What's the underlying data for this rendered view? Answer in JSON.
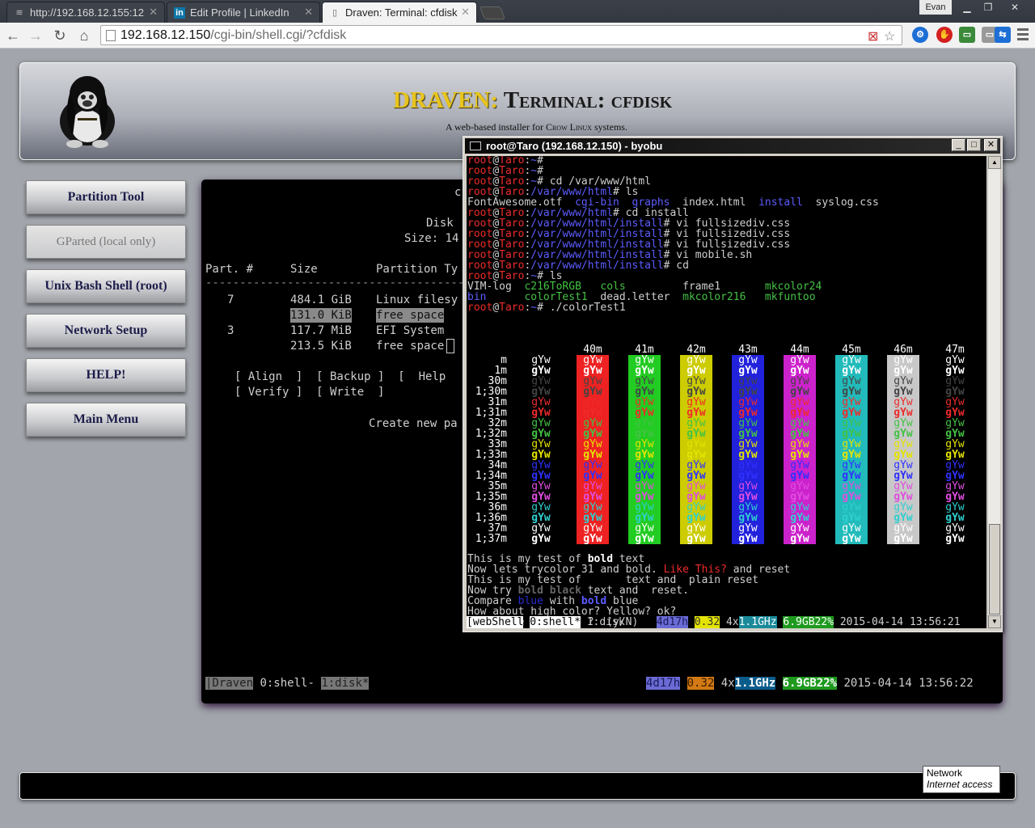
{
  "browser": {
    "tabs": [
      {
        "label": "http://192.168.12.155:12",
        "icon": "wifi-icon",
        "active": false
      },
      {
        "label": "Edit Profile | LinkedIn",
        "icon": "linkedin-icon",
        "active": false
      },
      {
        "label": "Draven: Terminal: cfdisk",
        "icon": "page-icon",
        "active": true
      }
    ],
    "user": "Evan",
    "url_host": "192.168.12.150",
    "url_path": "/cgi-bin/shell.cgi/?cfdisk"
  },
  "site": {
    "title_brand": "DRAVEN:",
    "title_rest": " Terminal: cfdisk",
    "tagline_pre": "A web-based installer for ",
    "tagline_brand": "Crow Linux",
    "tagline_post": " systems."
  },
  "sidebar": {
    "buttons": [
      {
        "label": "Partition Tool",
        "enabled": true
      },
      {
        "label": "GParted (local only)",
        "enabled": false
      },
      {
        "label": "Unix Bash Shell (root)",
        "enabled": true
      },
      {
        "label": "Network Setup",
        "enabled": true
      },
      {
        "label": "HELP!",
        "enabled": true
      },
      {
        "label": "Main Menu",
        "enabled": true
      }
    ]
  },
  "cfdisk": {
    "heading_c": "c",
    "disk_label": "Disk",
    "size_label": "Size: 14",
    "col_part": "Part. #",
    "col_size": "Size",
    "col_type": "Partition Ty",
    "rows": [
      {
        "part": "7",
        "size": "484.1 GiB",
        "type": "Linux filesy"
      },
      {
        "part": "",
        "size": "131.0 KiB",
        "type": "free space"
      },
      {
        "part": "3",
        "size": "117.7 MiB",
        "type": "EFI System"
      },
      {
        "part": "",
        "size": "213.5 KiB",
        "type": "free space"
      }
    ],
    "menu_line1": "[ Align  ]  [ Backup ]  [  Help",
    "menu_line2": "[ Verify ]  [ Write  ]",
    "hint": "Create new pa",
    "status": {
      "session": "|Draven",
      "win0": " 0:shell- ",
      "win1": "1:disk*",
      "uptime": "4d17h",
      "load": "0.32",
      "cpu_count": "4x",
      "cpu_freq": "1.1GHz",
      "mem": "6.9GB22%",
      "clock": " 2015-04-14 13:56:22"
    }
  },
  "putty": {
    "title": "root@Taro (192.168.12.150) - byobu",
    "status": {
      "session": "[webShell",
      "win0": "0:shell*",
      "win1": " 1:disk",
      "uptime": "4d17h",
      "load": "0.32",
      "cpu_count": "4x",
      "cpu_freq": "1.1GHz",
      "mem": "6.9GB22%",
      "clock": " 2015-04-14 13:56:21"
    },
    "color_columns": [
      "40m",
      "41m",
      "42m",
      "43m",
      "44m",
      "45m",
      "46m",
      "47m"
    ],
    "color_rows": [
      "m",
      "1m",
      "30m",
      "1;30m",
      "31m",
      "1;31m",
      "32m",
      "1;32m",
      "33m",
      "1;33m",
      "34m",
      "1;34m",
      "35m",
      "1;35m",
      "36m",
      "1;36m",
      "37m",
      "1;37m"
    ],
    "sample_text": "gYw",
    "tail_lines": [
      "This is my test of bold text",
      "Now lets trycolor 31 and bold. Like This? and reset",
      "This is my test of       text and  plain reset",
      "Now try bold black text and  reset.",
      "Compare blue with bold blue",
      "How about high color? Yellow? ok?",
      "Wanna see Nyan-Cat ?  (y/N)"
    ]
  },
  "tooltip": {
    "title": "Network",
    "subtitle": "Internet access"
  },
  "colors": {
    "brand_gold": "#e8c51e",
    "term_bg": "#000000",
    "red": "#ee2b2b",
    "green": "#44c244",
    "blue": "#5c5cff"
  }
}
